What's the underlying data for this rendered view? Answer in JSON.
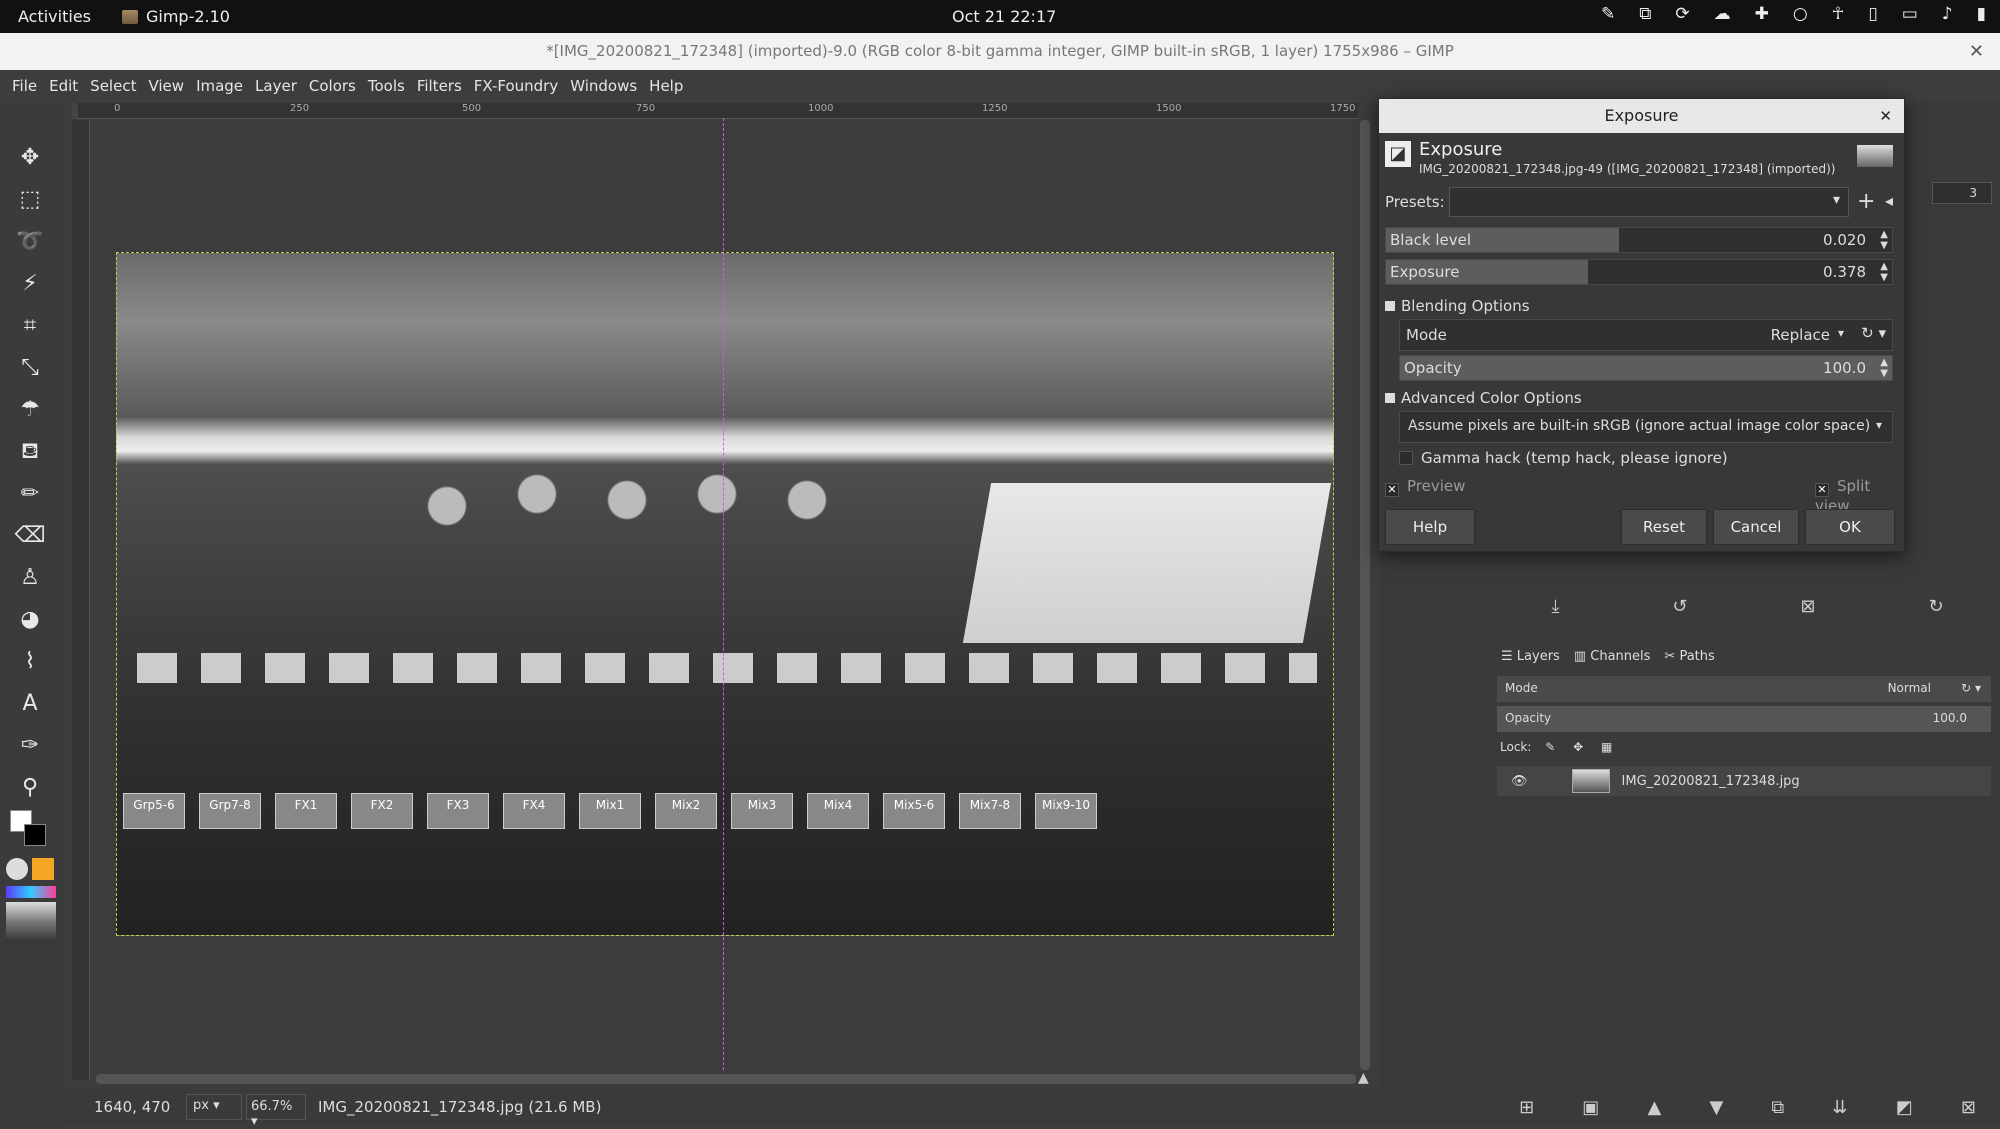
{
  "topbar": {
    "activities": "Activities",
    "app_name": "Gimp-2.10",
    "clock": "Oct 21  22:17"
  },
  "window": {
    "title": "*[IMG_20200821_172348] (imported)-9.0 (RGB color 8-bit gamma integer, GIMP built-in sRGB, 1 layer) 1755x986 – GIMP"
  },
  "menu": [
    "File",
    "Edit",
    "Select",
    "View",
    "Image",
    "Layer",
    "Colors",
    "Tools",
    "Filters",
    "FX-Foundry",
    "Windows",
    "Help"
  ],
  "ruler": {
    "ticks": [
      "0",
      "250",
      "500",
      "750",
      "1000",
      "1250",
      "1500",
      "1750"
    ]
  },
  "image_labels": [
    "Grp5-6",
    "Grp7-8",
    "FX1",
    "FX2",
    "FX3",
    "FX4",
    "Mix1",
    "Mix2",
    "Mix3",
    "Mix4",
    "Mix5-6",
    "Mix7-8",
    "Mix9-10"
  ],
  "status": {
    "coords": "1640, 470",
    "unit": "px",
    "zoom": "66.7%",
    "file": "IMG_20200821_172348.jpg (21.6 MB)"
  },
  "dock": {
    "spin_value": "3",
    "tabs": [
      "Layers",
      "Channels",
      "Paths"
    ],
    "mode_label": "Mode",
    "mode_value": "Normal",
    "opacity_label": "Opacity",
    "opacity_value": "100.0",
    "lock_label": "Lock:",
    "layer_name": "IMG_20200821_172348.jpg"
  },
  "dialog": {
    "window_title": "Exposure",
    "heading": "Exposure",
    "subheading": "IMG_20200821_172348.jpg-49 ([IMG_20200821_172348] (imported))",
    "presets_label": "Presets:",
    "black_level_label": "Black level",
    "black_level_value": "0.020",
    "exposure_label": "Exposure",
    "exposure_value": "0.378",
    "blending_header": "Blending Options",
    "mode_label": "Mode",
    "mode_value": "Replace",
    "opacity_label": "Opacity",
    "opacity_value": "100.0",
    "advanced_header": "Advanced Color Options",
    "assume_option": "Assume pixels are built-in sRGB (ignore actual image color space)",
    "gamma_hack": "Gamma hack (temp hack, please ignore)",
    "preview_label": "Preview",
    "split_view_label": "Split view",
    "help_button": "Help",
    "reset_button": "Reset",
    "cancel_button": "Cancel",
    "ok_button": "OK"
  },
  "colors": {
    "fg": "#ffffff",
    "bg": "#000000",
    "guide": "#e050e0",
    "selection": "#c8c850"
  }
}
